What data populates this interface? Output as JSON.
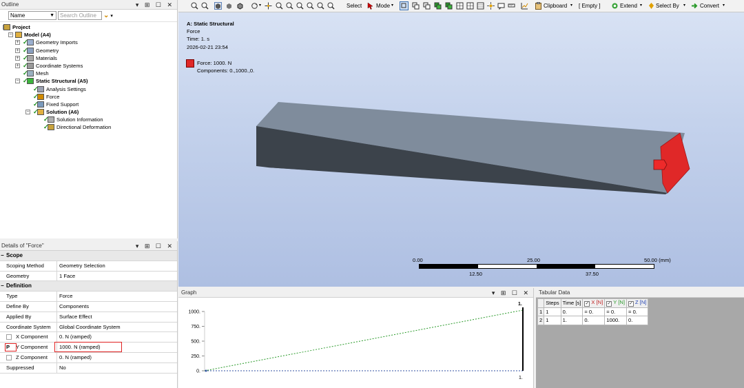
{
  "outline": {
    "title": "Outline",
    "name_select": "Name",
    "search_placeholder": "Search Outline",
    "tree": [
      {
        "label": "Project",
        "level": 0,
        "bold": true
      },
      {
        "label": "Model (A4)",
        "level": 1,
        "bold": true
      },
      {
        "label": "Geometry Imports",
        "level": 2,
        "bold": false
      },
      {
        "label": "Geometry",
        "level": 2,
        "bold": false
      },
      {
        "label": "Materials",
        "level": 2,
        "bold": false
      },
      {
        "label": "Coordinate Systems",
        "level": 2,
        "bold": false
      },
      {
        "label": "Mesh",
        "level": 2,
        "bold": false
      },
      {
        "label": "Static Structural (A5)",
        "level": 2,
        "bold": true
      },
      {
        "label": "Analysis Settings",
        "level": 3,
        "bold": false
      },
      {
        "label": "Force",
        "level": 3,
        "bold": false
      },
      {
        "label": "Fixed Support",
        "level": 3,
        "bold": false
      },
      {
        "label": "Solution (A6)",
        "level": 3,
        "bold": true
      },
      {
        "label": "Solution Information",
        "level": 4,
        "bold": false
      },
      {
        "label": "Directional Deformation",
        "level": 4,
        "bold": false
      }
    ]
  },
  "details": {
    "title": "Details of \"Force\"",
    "sections": [
      {
        "name": "Scope",
        "rows": [
          {
            "key": "Scoping Method",
            "value": "Geometry Selection"
          },
          {
            "key": "Geometry",
            "value": "1 Face"
          }
        ]
      },
      {
        "name": "Definition",
        "rows": [
          {
            "key": "Type",
            "value": "Force"
          },
          {
            "key": "Define By",
            "value": "Components"
          },
          {
            "key": "Applied By",
            "value": "Surface Effect"
          },
          {
            "key": "Coordinate System",
            "value": "Global Coordinate System"
          },
          {
            "key": "X Component",
            "value": "0. N  (ramped)"
          },
          {
            "key": "Y Component",
            "value": "1000. N  (ramped)"
          },
          {
            "key": "Z Component",
            "value": "0. N  (ramped)"
          },
          {
            "key": "Suppressed",
            "value": "No"
          }
        ]
      }
    ],
    "param_marker": "P"
  },
  "toolbar": {
    "select": "Select",
    "mode": "Mode",
    "clipboard": "Clipboard",
    "empty": "[ Empty ]",
    "extend": "Extend",
    "select_by": "Select By",
    "convert": "Convert"
  },
  "viewport": {
    "analysis": "A: Static Structural",
    "object": "Force",
    "time": "Time: 1. s",
    "datetime": "2026-02-21 23:54",
    "legend_label": "Force: 1000. N",
    "legend_components": "Components: 0.,1000.,0.",
    "scale": {
      "t0": "0.00",
      "t1": "25.00",
      "t2": "50.00 (mm)",
      "b1": "12.50",
      "b2": "37.50"
    },
    "colors": {
      "force": "#e02828",
      "body_top": "#7f8c9c",
      "body_front": "#3c434b"
    }
  },
  "graph": {
    "title": "Graph",
    "y_ticks": [
      "1000.",
      "750.",
      "500.",
      "250.",
      "0."
    ],
    "x_end_label": "1.",
    "top_label": "1."
  },
  "tabular": {
    "title": "Tabular Data",
    "headers": [
      "Steps",
      "Time [s]",
      "X [N]",
      "Y [N]",
      "Z [N]"
    ],
    "rows": [
      [
        "1",
        "1",
        "0.",
        "= 0.",
        "= 0.",
        "= 0."
      ],
      [
        "2",
        "1",
        "1.",
        "0.",
        "1000.",
        "0."
      ]
    ]
  }
}
